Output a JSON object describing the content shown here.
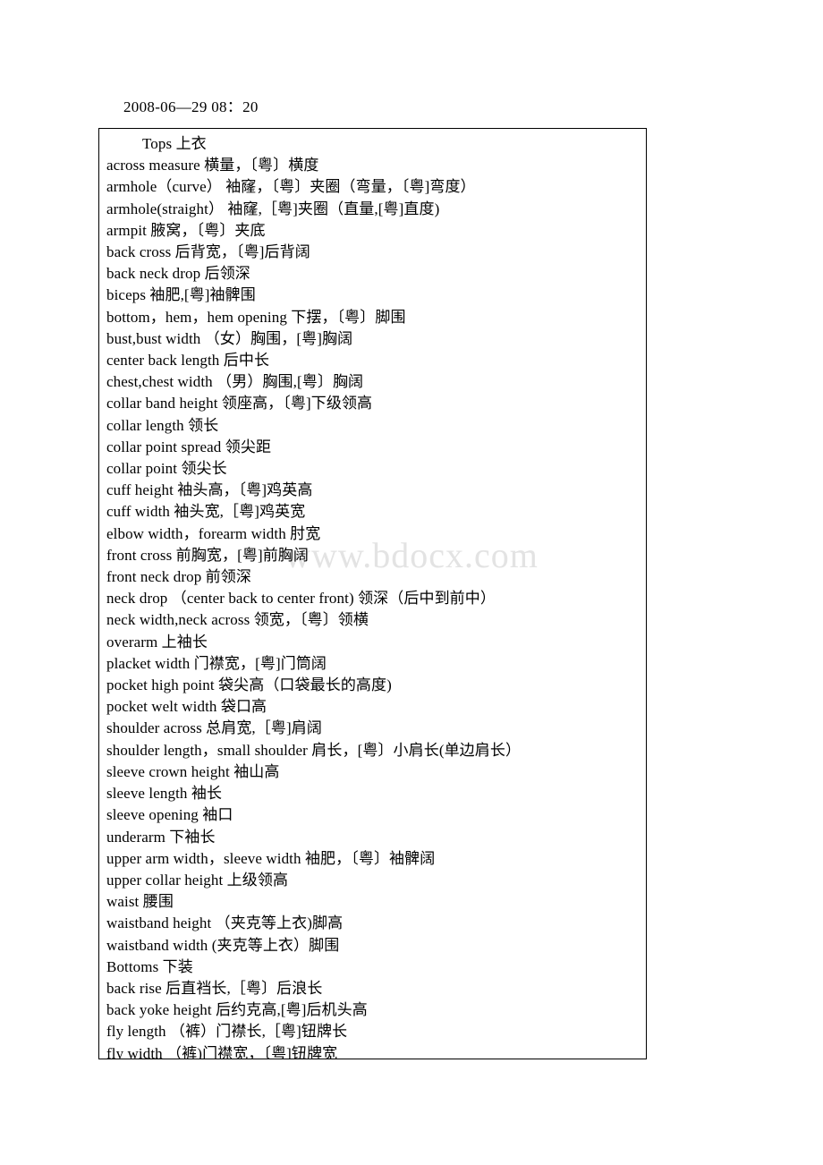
{
  "document": {
    "date_header": "2008-06—29 08：20",
    "watermark": "www.bdocx.com",
    "lines": [
      {
        "text": "Tops 上衣",
        "indent": true
      },
      {
        "text": "across measure 横量，〔粤〕横度",
        "indent": false
      },
      {
        "text": "armhole（curve） 袖窿，〔粤〕夹圈（弯量，〔粤]弯度）",
        "indent": false
      },
      {
        "text": "armhole(straight） 袖窿,［粤]夹圈（直量,[粤]直度)",
        "indent": false
      },
      {
        "text": "armpit 腋窝，〔粤〕夹底",
        "indent": false
      },
      {
        "text": "back cross 后背宽，〔粤]后背阔",
        "indent": false
      },
      {
        "text": "back neck drop 后领深",
        "indent": false
      },
      {
        "text": "biceps 袖肥,[粤]袖髀围",
        "indent": false
      },
      {
        "text": "bottom，hem，hem opening 下摆，〔粤〕脚围",
        "indent": false
      },
      {
        "text": "bust,bust width （女）胸围，[粤]胸阔",
        "indent": false
      },
      {
        "text": "center back length 后中长",
        "indent": false
      },
      {
        "text": "chest,chest width （男）胸围,[粤〕胸阔",
        "indent": false
      },
      {
        "text": "collar band height 领座高，〔粤]下级领高",
        "indent": false
      },
      {
        "text": "collar length 领长",
        "indent": false
      },
      {
        "text": "collar point spread 领尖距",
        "indent": false
      },
      {
        "text": "collar point 领尖长",
        "indent": false
      },
      {
        "text": "cuff height 袖头高，〔粤]鸡英高",
        "indent": false
      },
      {
        "text": "cuff width 袖头宽,［粤]鸡英宽",
        "indent": false
      },
      {
        "text": "elbow width，forearm width 肘宽",
        "indent": false
      },
      {
        "text": "front cross 前胸宽，[粤]前胸阔",
        "indent": false
      },
      {
        "text": "front neck drop 前领深",
        "indent": false
      },
      {
        "text": "neck drop （center back to center front) 领深（后中到前中）",
        "indent": false
      },
      {
        "text": "neck width,neck across 领宽，〔粤〕领横",
        "indent": false
      },
      {
        "text": "overarm 上袖长",
        "indent": false
      },
      {
        "text": "placket width 门襟宽，[粤]门筒阔",
        "indent": false
      },
      {
        "text": "pocket high point 袋尖高（口袋最长的高度)",
        "indent": false
      },
      {
        "text": "pocket welt width 袋口高",
        "indent": false
      },
      {
        "text": "shoulder across 总肩宽,［粤]肩阔",
        "indent": false
      },
      {
        "text": "shoulder length，small shoulder 肩长，[粤〕小肩长(单边肩长）",
        "indent": false
      },
      {
        "text": "sleeve crown height 袖山高",
        "indent": false
      },
      {
        "text": "sleeve length 袖长",
        "indent": false
      },
      {
        "text": "sleeve opening 袖口",
        "indent": false
      },
      {
        "text": "underarm 下袖长",
        "indent": false
      },
      {
        "text": "upper arm width，sleeve width 袖肥，〔粤〕袖髀阔",
        "indent": false
      },
      {
        "text": "upper collar height 上级领高",
        "indent": false
      },
      {
        "text": "waist 腰围",
        "indent": false
      },
      {
        "text": "waistband height （夹克等上衣)脚高",
        "indent": false
      },
      {
        "text": "waistband width (夹克等上衣）脚围",
        "indent": false
      },
      {
        "text": "Bottoms 下装",
        "indent": false
      },
      {
        "text": "back rise 后直裆长,［粤〕后浪长",
        "indent": false
      },
      {
        "text": "back yoke height 后约克高,[粤]后机头高",
        "indent": false
      },
      {
        "text": "fly length （裤）门襟长,［粤]钮牌长",
        "indent": false
      },
      {
        "text": "fly width （裤)门襟宽，〔粤]钮牌宽",
        "indent": false
      }
    ]
  }
}
